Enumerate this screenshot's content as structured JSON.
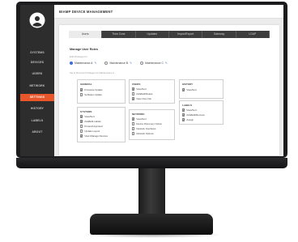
{
  "app_title": "BIAMP DEVICE MANAGEMENT",
  "sidebar": {
    "items": [
      {
        "label": "SYSTEMS",
        "active": false
      },
      {
        "label": "DEVICES",
        "active": false
      },
      {
        "label": "USERS",
        "active": false
      },
      {
        "label": "NETWORK",
        "active": false
      },
      {
        "label": "SETTINGS",
        "active": true
      },
      {
        "label": "HISTORY",
        "active": false
      },
      {
        "label": "LABELS",
        "active": false
      },
      {
        "label": "ABOUT",
        "active": false
      }
    ]
  },
  "tabs": [
    {
      "label": "Users",
      "active": true
    },
    {
      "label": "Time Zone",
      "active": false
    },
    {
      "label": "Updates",
      "active": false
    },
    {
      "label": "Import/Export",
      "active": false
    },
    {
      "label": "Gateway",
      "active": false
    },
    {
      "label": "LDAP",
      "active": false
    }
  ],
  "main": {
    "section_title": "Manage User Roles",
    "edit_label": "Edit Privileges for",
    "roles": [
      {
        "label": "Maintenance A",
        "selected": true
      },
      {
        "label": "Maintenance B",
        "selected": false
      },
      {
        "label": "Maintenance C",
        "selected": false
      }
    ],
    "privileges_label": "Set or Remove Privileges for Maintenance A"
  },
  "panels": {
    "general": {
      "title": "GENERAL",
      "items": [
        {
          "label": "Firmware Update",
          "checked": true
        },
        {
          "label": "Software Update",
          "checked": false
        }
      ]
    },
    "users": {
      "title": "USERS",
      "items": [
        {
          "label": "View/Sort",
          "checked": true
        },
        {
          "label": "Add/Edit/Delete",
          "checked": false
        },
        {
          "label": "View Own Info",
          "checked": true
        }
      ]
    },
    "history": {
      "title": "HISTORY",
      "items": [
        {
          "label": "View/Sort",
          "checked": true
        }
      ]
    },
    "systems": {
      "title": "SYSTEMS",
      "items": [
        {
          "label": "View/Sort",
          "checked": true
        },
        {
          "label": "Add/Edit Labels",
          "checked": true
        },
        {
          "label": "Protect/Unprotect",
          "checked": false
        },
        {
          "label": "Update Layout",
          "checked": false
        },
        {
          "label": "View Manage Devices",
          "checked": true
        }
      ]
    },
    "network": {
      "title": "NETWORK",
      "items": [
        {
          "label": "View/Sort",
          "checked": true
        },
        {
          "label": "Device Discovery Option",
          "checked": false
        },
        {
          "label": "Network Interfaces",
          "checked": false
        },
        {
          "label": "Network Options",
          "checked": false
        }
      ]
    },
    "labels": {
      "title": "LABELS",
      "items": [
        {
          "label": "View/Sort",
          "checked": true
        },
        {
          "label": "Add/Edit/Remove",
          "checked": true
        },
        {
          "label": "Assign",
          "checked": true
        }
      ]
    }
  },
  "colors": {
    "accent": "#e8562a",
    "sidebar_bg": "#2d2d2d",
    "tab_bg": "#3d3d3d",
    "link_blue": "#3d6bd6"
  }
}
